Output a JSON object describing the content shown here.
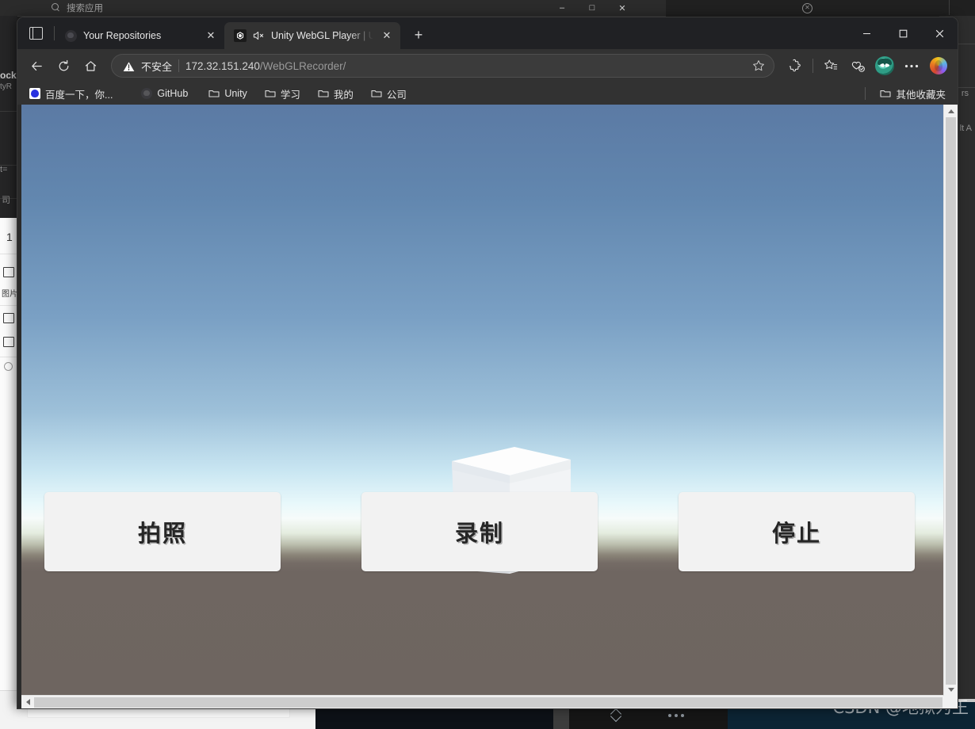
{
  "background": {
    "search_placeholder": "搜索应用",
    "window_controls": [
      "–",
      "□",
      "✕"
    ],
    "fragments": {
      "lock_line1": "ock",
      "lock_line2": "tyR",
      "eq": "t=",
      "ci": "司",
      "num": "1",
      "pic_label": "图片",
      "right_rs": "rs",
      "right_lt": "lt A"
    }
  },
  "watermark": "CSDN @地狱为王",
  "browser": {
    "tab_tools_icon": "tab-search-icon",
    "tabs": [
      {
        "title": "Your Repositories",
        "favicon": "github-icon",
        "active": false,
        "close": "✕"
      },
      {
        "title": "Unity WebGL Player | U",
        "favicon": "unity-icon",
        "muted_icon": "speaker-muted-icon",
        "active": true,
        "close": "✕"
      }
    ],
    "new_tab_label": "+",
    "window_controls": {
      "minimize": "minimize-icon",
      "maximize": "maximize-icon",
      "close": "close-icon"
    },
    "toolbar": {
      "back": "back-arrow-icon",
      "reload": "reload-icon",
      "home": "home-icon",
      "security_label": "不安全",
      "url_host": "172.32.151.240",
      "url_path": "/WebGLRecorder/",
      "favorite_star": "star-icon",
      "extensions": "extensions-puzzle-icon",
      "favorites": "favorites-star-icon",
      "collections": "collections-icon",
      "profile": "profile-avatar",
      "settings": "more-dots-icon",
      "copilot": "copilot-icon"
    },
    "bookmarks": {
      "items": [
        {
          "label": "百度一下，你...",
          "icon": "baidu-icon"
        },
        {
          "label": "GitHub",
          "icon": "github-icon"
        },
        {
          "label": "Unity",
          "icon": "folder-icon"
        },
        {
          "label": "学习",
          "icon": "folder-icon"
        },
        {
          "label": "我的",
          "icon": "folder-icon"
        },
        {
          "label": "公司",
          "icon": "folder-icon"
        }
      ],
      "other_favorites": "其他收藏夹"
    }
  },
  "unity": {
    "buttons": [
      {
        "label": "拍照"
      },
      {
        "label": "录制"
      },
      {
        "label": "停止"
      }
    ],
    "colors": {
      "sky_top": "#5b7aa4",
      "horizon": "#e8f8fb",
      "ground": "#6e6560",
      "button_face": "#f2f2f2",
      "button_text": "#262626"
    },
    "scene": {
      "object": "white-cube"
    }
  }
}
